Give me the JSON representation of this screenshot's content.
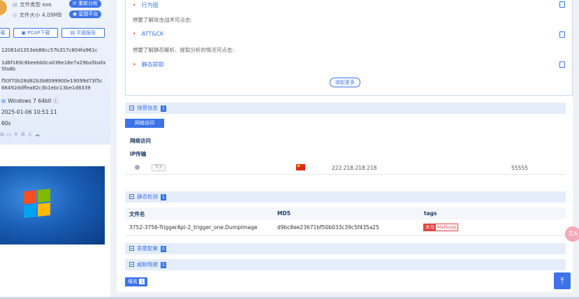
{
  "sample": {
    "file_type": "文件类型 exe",
    "file_size": "文件大小 4.09MB",
    "reanalyze": "重新分析",
    "platform": "星图平台",
    "downloads": [
      "载",
      "PCAP下载",
      "平面报告"
    ],
    "hash1": "12061d1353eb88cc57b317c804fa961c",
    "hash2_a": "1d6f169c6beebb0ca036e16e7a29ba5bafa",
    "hash2_b": "5fa8b",
    "hash3_a": "f50f70b28d82b3b8099900e19099d73f5c",
    "hash3_b": "66492ddffea82c3b1ebc13be1d8339",
    "os": "Windows 7 64bit",
    "time": "2025-01-06 10:51:11",
    "duration": "60s"
  },
  "behavior": {
    "item1": "行为图",
    "hint1": "想要了解攻击战术可点击:",
    "item2": "ATT&CK",
    "hint2": "想要了解静态解析、提取分析的情况可点击:",
    "item3": "静态提取",
    "collapse": "收起更多"
  },
  "scene": {
    "title": "场景信息",
    "count": "1",
    "tab": "网络访问",
    "label": "网络访问",
    "sub": "IP传输",
    "row": {
      "proto": "TCP",
      "ip": "222.218.218.218",
      "port": "55555"
    }
  },
  "static": {
    "title": "静态检测",
    "count": "1",
    "headers": [
      "文件名",
      "MD5",
      "tags"
    ],
    "row": {
      "file": "3752-3756-TriggerApi-2_trigger_one.DumpImage",
      "md5": "d9bc8ee23671bf50b033c39c5f435a25",
      "tag1": "木马",
      "tag2": "MalSusp"
    }
  },
  "malconfig": {
    "title": "恶意配置",
    "count": "0"
  },
  "threat": {
    "title": "威胁情报",
    "count": "1",
    "tab": "域名",
    "tab_count": "1"
  },
  "colors": {
    "accent": "#3b73e8",
    "danger": "#e04444"
  }
}
